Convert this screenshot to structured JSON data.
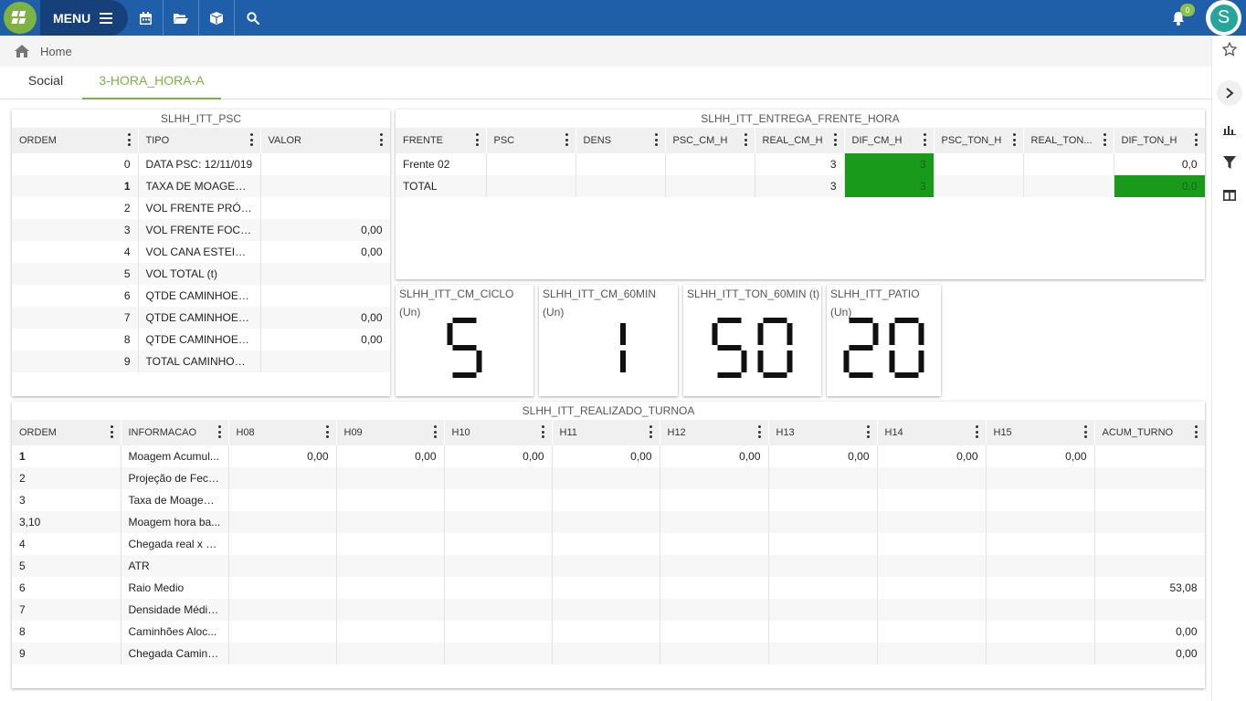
{
  "topbar": {
    "menu_label": "MENU",
    "notification_count": "0",
    "avatar_letter": "S",
    "accent": "#1f5ea8",
    "brand_green": "#7cb342"
  },
  "breadcrumb": {
    "home": "Home"
  },
  "tabs": [
    {
      "label": "Social"
    },
    {
      "label": "3-HORA_HORA-A"
    }
  ],
  "psc": {
    "title": "SLHH_ITT_PSC",
    "columns": [
      "ORDEM",
      "TIPO",
      "VALOR"
    ],
    "rows": [
      [
        "0",
        "DATA PSC: 12/11/019",
        ""
      ],
      [
        "1",
        "TAXA DE MOAGEM I...",
        ""
      ],
      [
        "2",
        "VOL FRENTE PRÓPR...",
        ""
      ],
      [
        "3",
        "VOL FRENTE FOCA (t)",
        "0,00"
      ],
      [
        "4",
        "VOL CANA ESTEIRA ...",
        "0,00"
      ],
      [
        "5",
        "VOL TOTAL (t)",
        ""
      ],
      [
        "6",
        "QTDE CAMINHOES ...",
        ""
      ],
      [
        "7",
        "QTDE CAMINHOES F...",
        "0,00"
      ],
      [
        "8",
        "QTDE CAMINHOES ...",
        "0,00"
      ],
      [
        "9",
        "TOTAL CAMINHOES ...",
        ""
      ]
    ]
  },
  "entrega": {
    "title": "SLHH_ITT_ENTREGA_FRENTE_HORA",
    "columns": [
      "FRENTE",
      "PSC",
      "DENS",
      "PSC_CM_H",
      "REAL_CM_H",
      "DIF_CM_H",
      "PSC_TON_H",
      "REAL_TON...",
      "DIF_TON_H"
    ],
    "rows": [
      [
        "Frente 02",
        "",
        "",
        "",
        "3",
        "3",
        "",
        "",
        "0,0"
      ],
      [
        "TOTAL",
        "",
        "",
        "",
        "3",
        "3",
        "",
        "",
        "0,0"
      ]
    ]
  },
  "kpis": [
    {
      "title": "SLHH_ITT_CM_CICLO (Un)",
      "value": "5"
    },
    {
      "title": "SLHH_ITT_CM_60MIN (Un)",
      "value": "1"
    },
    {
      "title": "SLHH_ITT_TON_60MIN (t)",
      "value": "50"
    },
    {
      "title": "SLHH_ITT_PATIO (Un)",
      "value": "20"
    }
  ],
  "turno": {
    "title": "SLHH_ITT_REALIZADO_TURNOA",
    "columns": [
      "ORDEM",
      "INFORMACAO",
      "H08",
      "H09",
      "H10",
      "H11",
      "H12",
      "H13",
      "H14",
      "H15",
      "ACUM_TURNO"
    ],
    "rows": [
      [
        "1",
        "Moagem Acumul...",
        "0,00",
        "0,00",
        "0,00",
        "0,00",
        "0,00",
        "0,00",
        "0,00",
        "0,00",
        ""
      ],
      [
        "2",
        "Projeção de Fech...",
        "",
        "",
        "",
        "",
        "",
        "",
        "",
        "",
        ""
      ],
      [
        "3",
        "Taxa de Moagem...",
        "",
        "",
        "",
        "",
        "",
        "",
        "",
        "",
        ""
      ],
      [
        "3,10",
        "Moagem hora ba...",
        "",
        "",
        "",
        "",
        "",
        "",
        "",
        "",
        ""
      ],
      [
        "4",
        "Chegada real x d...",
        "",
        "",
        "",
        "",
        "",
        "",
        "",
        "",
        ""
      ],
      [
        "5",
        "ATR",
        "",
        "",
        "",
        "",
        "",
        "",
        "",
        "",
        ""
      ],
      [
        "6",
        "Raio Medio",
        "",
        "",
        "",
        "",
        "",
        "",
        "",
        "",
        "53,08"
      ],
      [
        "7",
        "Densidade Média...",
        "",
        "",
        "",
        "",
        "",
        "",
        "",
        "",
        ""
      ],
      [
        "8",
        "Caminhões Aloc...",
        "",
        "",
        "",
        "",
        "",
        "",
        "",
        "",
        "0,00"
      ],
      [
        "9",
        "Chegada Caminh...",
        "",
        "",
        "",
        "",
        "",
        "",
        "",
        "",
        "0,00"
      ]
    ]
  }
}
